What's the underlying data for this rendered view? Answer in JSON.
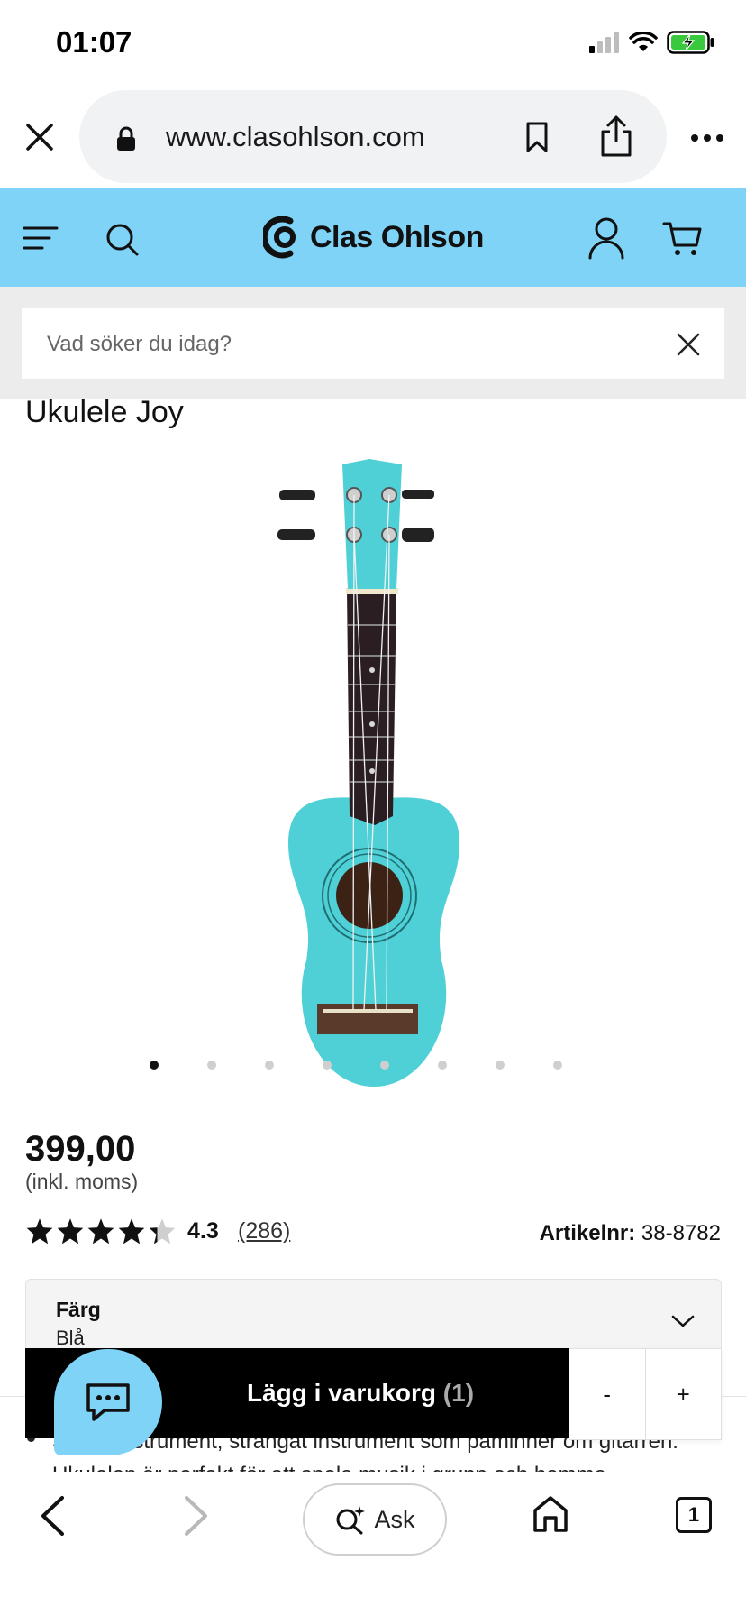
{
  "status_bar": {
    "time": "01:07",
    "icons": [
      "signal-icon",
      "wifi-icon",
      "battery-charging-icon"
    ]
  },
  "browser": {
    "url": "www.clasohlson.com",
    "icons": [
      "close-icon",
      "lock-icon",
      "bookmark-icon",
      "share-icon",
      "more-icon"
    ]
  },
  "site_header": {
    "brand": "Clas Ohlson",
    "icons": [
      "menu-icon",
      "search-icon",
      "account-icon",
      "cart-icon"
    ],
    "background": "#7fd3f7"
  },
  "search": {
    "placeholder": "Vad söker du idag?"
  },
  "product": {
    "title": "Ukulele Joy",
    "image_icon": "ukulele-image",
    "ukulele_color": "#4fd0d6",
    "carousel_dots": 8,
    "carousel_active_index": 0,
    "price": "399,00",
    "vat_note": "(inkl. moms)",
    "rating_value": "4.3",
    "rating_stars": 4.3,
    "review_count": "(286)",
    "article_label": "Artikelnr:",
    "article_number": "38-8782",
    "color_label": "Färg",
    "color_value": "Blå",
    "description_visible": [
      "Stränginstrument, strängat instrument som påminner om gitarren.",
      "Ukulelen är perfekt för att spela musik i grupp och hemma"
    ]
  },
  "cart": {
    "add_label": "Lägg i varukorg",
    "quantity": "(1)",
    "minus": "-",
    "plus": "+"
  },
  "chat": {
    "icon": "chat-icon"
  },
  "toolbar": {
    "ask_label": "Ask",
    "tabs_count": "1",
    "icons": [
      "back-icon",
      "forward-icon",
      "ask-sparkle-icon",
      "home-icon",
      "tabs-icon"
    ]
  }
}
